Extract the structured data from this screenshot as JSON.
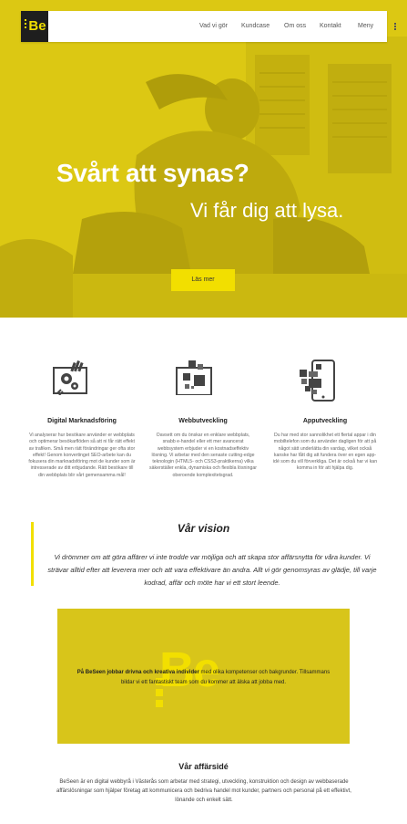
{
  "nav": {
    "logo_text": "Be",
    "links": [
      "Vad vi gör",
      "Kundcase",
      "Om oss",
      "Kontakt",
      "Meny"
    ]
  },
  "hero": {
    "title": "Svårt att synas?",
    "subtitle": "Vi får dig att lysa.",
    "button_label": "Läs mer"
  },
  "services": [
    {
      "icon": "marketing-gears-icon",
      "title": "Digital Marknadsföring",
      "text": "Vi analyserar hur besökare använder er webbplats och optimerar besökarflöden så att ni får rätt effekt av trafiken. Små men rätt förändringar ger ofta stor effekt! Genom konvertinget SEO-arbete kan du fokusera din marknadsföring mot de kunder som är intresserade av ditt erbjudande. Rätt besökare till din webbplats blir vårt gemensamma mål!"
    },
    {
      "icon": "web-blocks-icon",
      "title": "Webbutveckling",
      "text": "Oavsett om du önskar en enklare webbplats, snabb e-handel eller ett mer avancerat webbsystem erbjuder vi en kostnadseffektiv lösning. Vi arbetar med den senaste cutting-edge teknologin (HTML5- och CSS3-praktikerna) vilka säkerställer enkla, dynamiska och flexibla lösningar oberoende komplexitetsgrad."
    },
    {
      "icon": "mobile-app-icon",
      "title": "Apputveckling",
      "text": "Du har med stor sannolikhet ett flertal appar i din mobiltelefon som du använder dagligen för att på något sätt underlätta din vardag, vilket också kanske har fått dig att fundera över en egen app-idé som du vill förverkliga. Det är också har vi kan komma in för att hjälpa dig."
    }
  ],
  "vision": {
    "title": "Vår vision",
    "text": "Vi drömmer om att göra affärer vi inte trodde var möjliga och att skapa stor affärsnytta för våra kunder. Vi strävar alltid efter att leverera mer och att vara effektivare än andra. Allt vi gör genomsyras av glädje, till varje kodrad, affär och möte har vi ett stort leende."
  },
  "team": {
    "logo_text": "Be",
    "text_bold": "På BeSeen jobbar drivna och kreativa individer",
    "text_rest": " med olika kompetenser och bakgrunder. Tillsammans bildar vi ett fantastiskt team som du kommer att älska att jobba med."
  },
  "business": {
    "title": "Vår affärsidé",
    "text": "BeSeen är en digital webbyrå i Västerås som arbetar med strategi, utveckling, konstruktion och design av webbaserade affärslösningar som hjälper företag att kommunicera och bedriva handel mot kunder, partners och personal på ett effektivt, lönande och enkelt sätt."
  },
  "colors": {
    "accent": "#f2df00",
    "hero_tint": "#d8c51a",
    "dark": "#1e1e1e"
  }
}
